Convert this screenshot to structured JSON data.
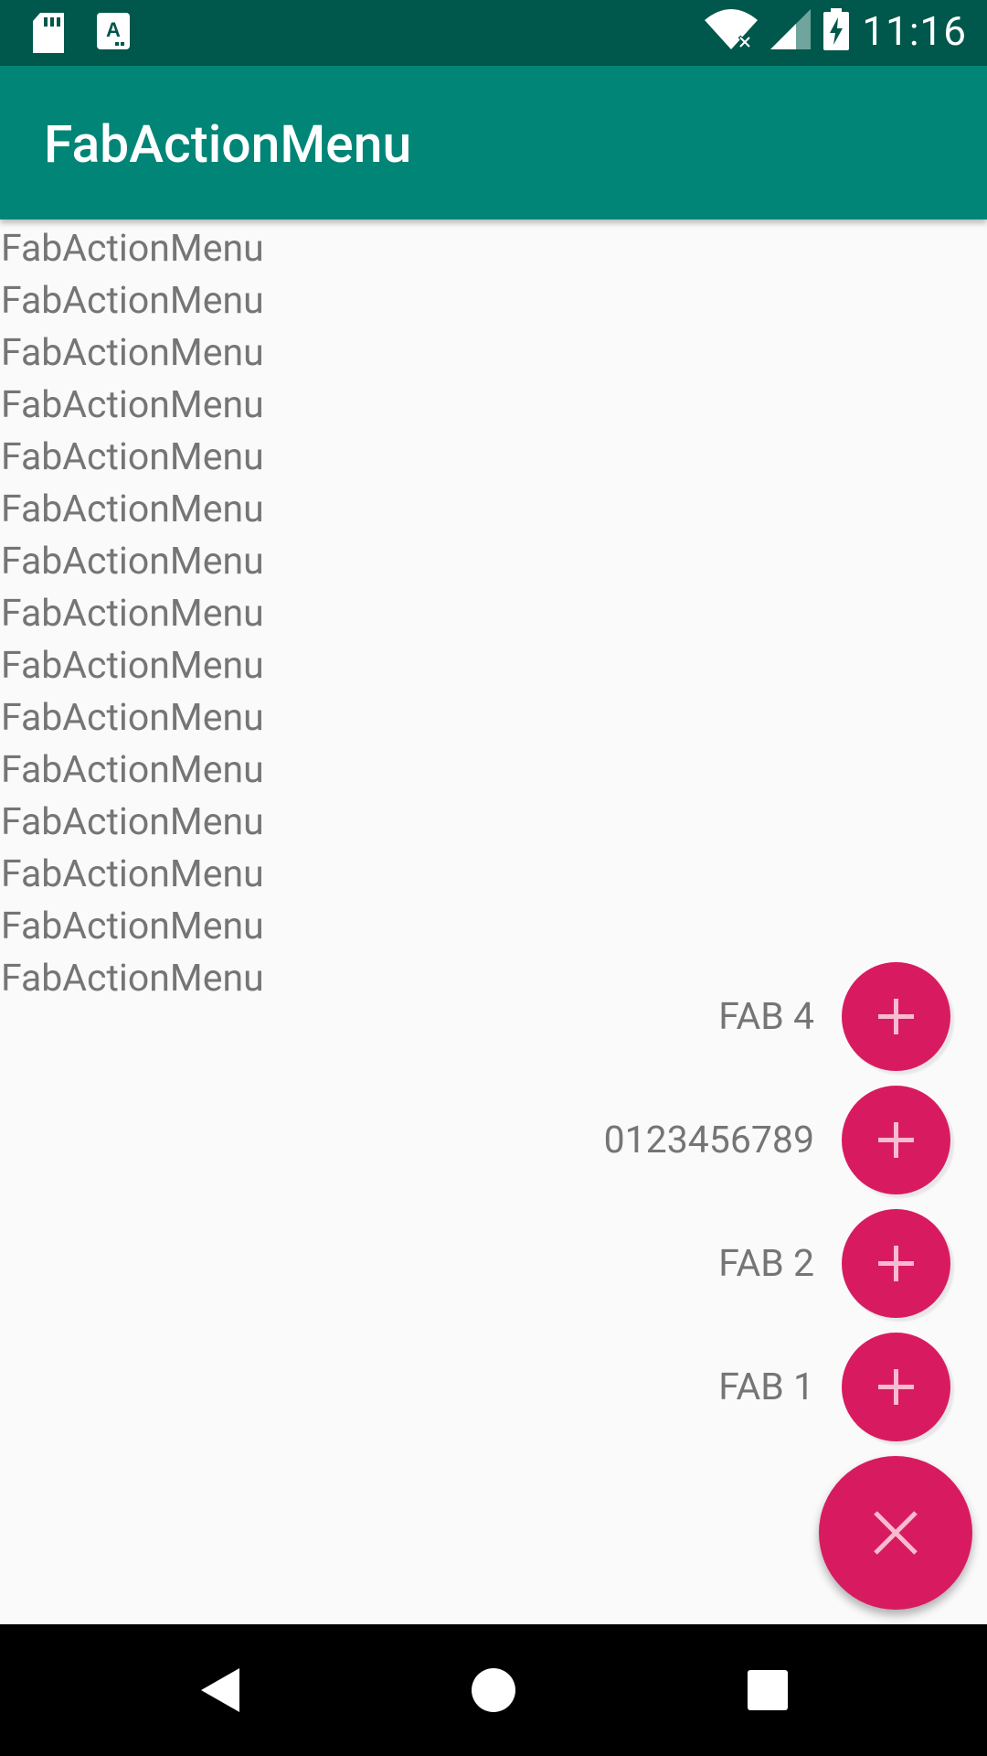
{
  "status_bar": {
    "time": "11:16",
    "icons": [
      "sd-card-icon",
      "text-app-icon",
      "wifi-icon",
      "cell-signal-icon",
      "battery-charging-icon"
    ]
  },
  "app_bar": {
    "title": "FabActionMenu"
  },
  "list": {
    "items": [
      "FabActionMenu",
      "FabActionMenu",
      "FabActionMenu",
      "FabActionMenu",
      "FabActionMenu",
      "FabActionMenu",
      "FabActionMenu",
      "FabActionMenu",
      "FabActionMenu",
      "FabActionMenu",
      "FabActionMenu",
      "FabActionMenu",
      "FabActionMenu",
      "FabActionMenu",
      "FabActionMenu"
    ]
  },
  "fab_menu": {
    "items": [
      {
        "label": "FAB 4",
        "icon": "plus-icon"
      },
      {
        "label": "0123456789",
        "icon": "plus-icon"
      },
      {
        "label": "FAB 2",
        "icon": "plus-icon"
      },
      {
        "label": "FAB 1",
        "icon": "plus-icon"
      }
    ],
    "main_icon": "close-icon"
  },
  "nav_bar": {
    "buttons": [
      "back-icon",
      "home-icon",
      "recents-icon"
    ]
  },
  "colors": {
    "status_bar": "#00574B",
    "app_bar": "#008577",
    "accent": "#D81B60",
    "background": "#FAFAFA",
    "text_secondary": "#757575"
  }
}
